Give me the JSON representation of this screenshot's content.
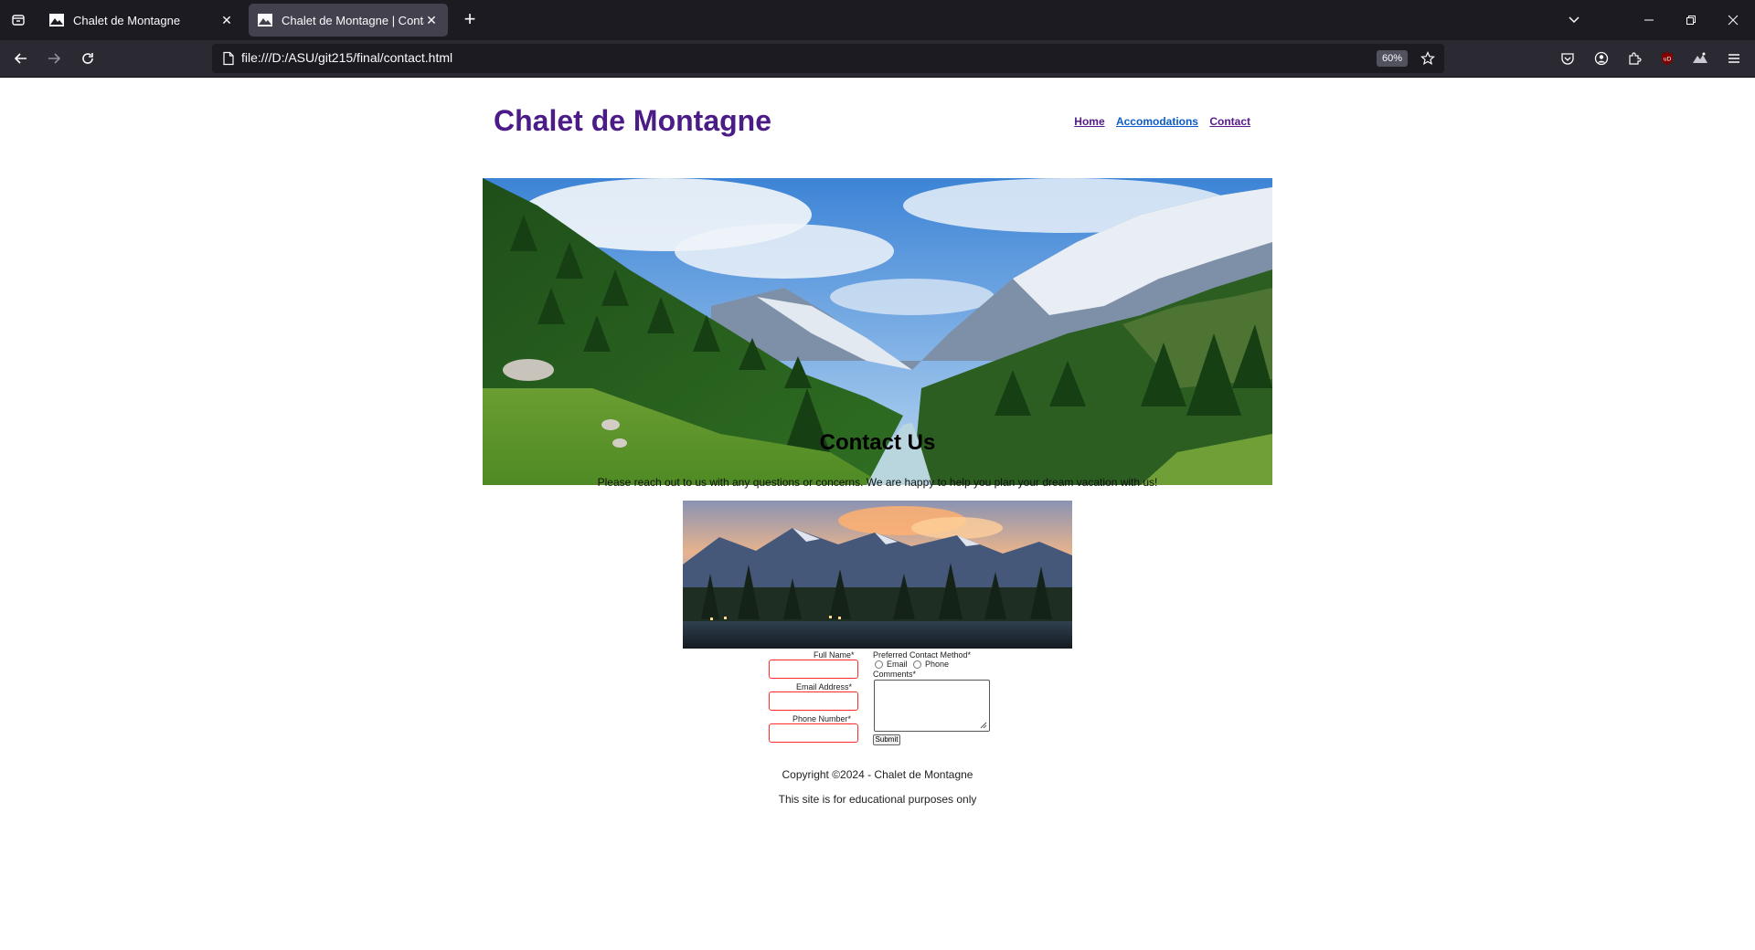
{
  "browser": {
    "tabs": [
      {
        "title": "Chalet de Montagne",
        "active": false
      },
      {
        "title": "Chalet de Montagne | Contact",
        "active": true
      }
    ],
    "url": "file:///D:/ASU/git215/final/contact.html",
    "zoom": "60%"
  },
  "site": {
    "title": "Chalet de Montagne",
    "nav": [
      {
        "label": "Home",
        "state": "visited"
      },
      {
        "label": "Accomodations",
        "state": "unvisited"
      },
      {
        "label": "Contact",
        "state": "visited"
      }
    ],
    "colors": {
      "title": "#4b1b87",
      "visited_link": "#551a8b",
      "link": "#0d5bc8",
      "invalid_border": "#ff2a2a"
    }
  },
  "contact": {
    "heading": "Contact Us",
    "intro": "Please reach out to us with any questions or concerns. We are happy to help you plan your dream vacation with us!"
  },
  "form": {
    "full_name_label": "Full Name*",
    "email_label": "Email Address*",
    "phone_label": "Phone Number*",
    "method_label": "Preferred Contact Method*",
    "method_options": [
      "Email",
      "Phone"
    ],
    "comments_label": "Comments*",
    "submit_label": "Submit"
  },
  "footer": {
    "copyright": "Copyright ©2024 - Chalet de Montagne",
    "note": "This site is for educational purposes only"
  }
}
